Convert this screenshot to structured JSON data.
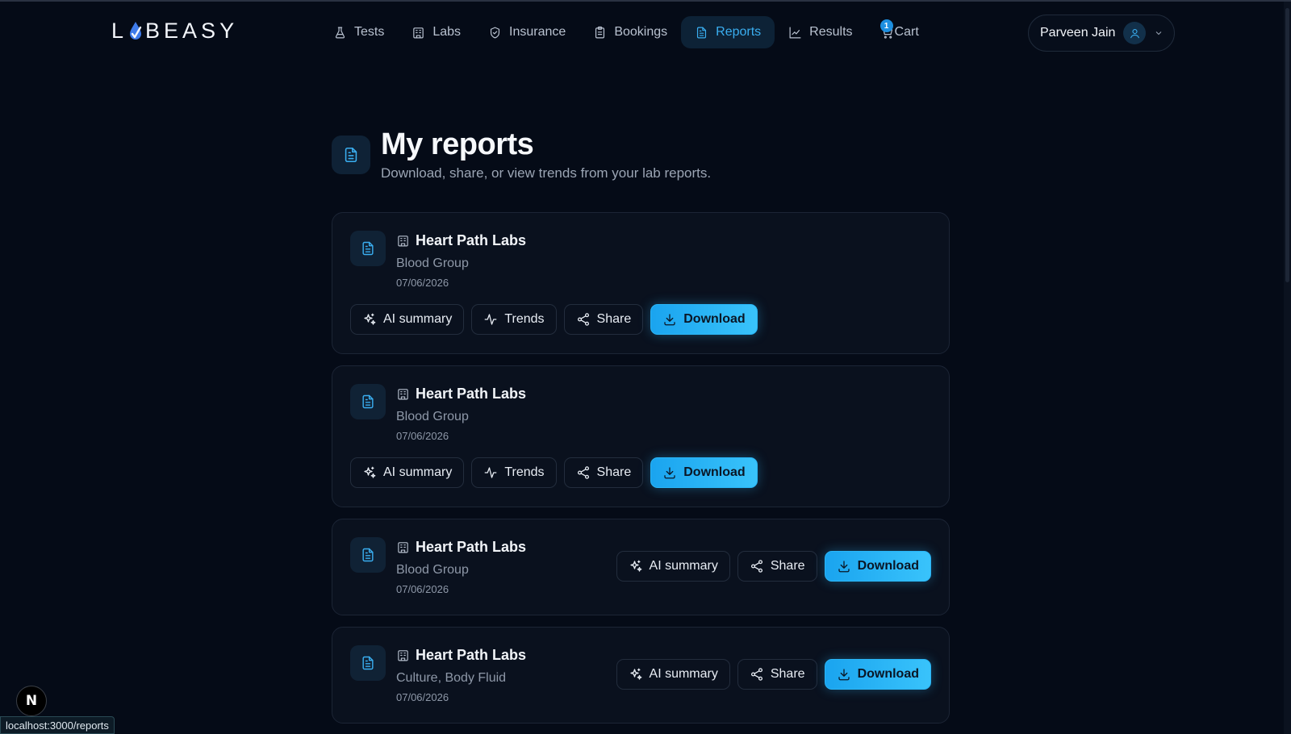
{
  "logo": {
    "text_left": "L",
    "text_right": "BEASY"
  },
  "nav": {
    "items": [
      {
        "label": "Tests",
        "icon": "flask-icon"
      },
      {
        "label": "Labs",
        "icon": "building-icon"
      },
      {
        "label": "Insurance",
        "icon": "shield-icon"
      },
      {
        "label": "Bookings",
        "icon": "clipboard-icon"
      },
      {
        "label": "Reports",
        "icon": "document-icon",
        "active": true
      },
      {
        "label": "Results",
        "icon": "chart-line-icon"
      },
      {
        "label": "Cart",
        "icon": "cart-icon",
        "badge": "1"
      }
    ]
  },
  "user": {
    "name": "Parveen Jain"
  },
  "page": {
    "title": "My reports",
    "subtitle": "Download, share, or view trends from your lab reports."
  },
  "reports": [
    {
      "lab": "Heart Path Labs",
      "test": "Blood Group",
      "date": "07/06/2026"
    },
    {
      "lab": "Heart Path Labs",
      "test": "Blood Group",
      "date": "07/06/2026"
    },
    {
      "lab": "Heart Path Labs",
      "test": "Blood Group",
      "date": "07/06/2026"
    },
    {
      "lab": "Heart Path Labs",
      "test": "Culture, Body Fluid",
      "date": "07/06/2026"
    }
  ],
  "actions": {
    "ai_summary": "AI summary",
    "trends": "Trends",
    "share": "Share",
    "download": "Download"
  },
  "status_bar": {
    "url": "localhost:3000/reports"
  },
  "next_badge": "N",
  "colors": {
    "accent": "#3aaef0",
    "background": "#050b17",
    "card": "#0a111e"
  }
}
